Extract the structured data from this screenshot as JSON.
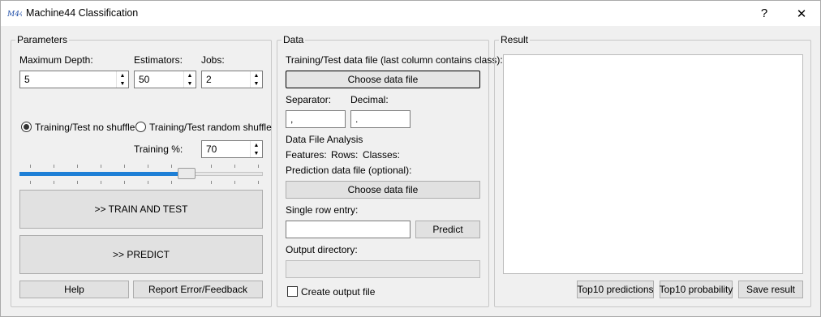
{
  "window": {
    "title": "Machine44 Classification",
    "help_glyph": "?",
    "close_glyph": "✕"
  },
  "parameters": {
    "group_title": "Parameters",
    "max_depth": {
      "label": "Maximum Depth:",
      "value": "5"
    },
    "estimators": {
      "label": "Estimators:",
      "value": "50"
    },
    "jobs": {
      "label": "Jobs:",
      "value": "2"
    },
    "radio_no_shuffle": "Training/Test no shuffle",
    "radio_random_shuffle": "Training/Test random shuffle",
    "selected_mode": "no_shuffle",
    "training_pct": {
      "label": "Training %:",
      "value": "70"
    },
    "slider_value_pct": 70,
    "train_button": ">> TRAIN AND TEST",
    "predict_button": ">> PREDICT",
    "help_button": "Help",
    "report_button": "Report Error/Feedback"
  },
  "data": {
    "group_title": "Data",
    "training_file_label": "Training/Test data file (last column contains class):",
    "choose_button_1": "Choose data file",
    "separator_label": "Separator:",
    "separator_value": ",",
    "decimal_label": "Decimal:",
    "decimal_value": ".",
    "analysis_label": "Data File Analysis",
    "features_label": "Features:",
    "rows_label": "Rows:",
    "classes_label": "Classes:",
    "prediction_file_label": "Prediction data file (optional):",
    "choose_button_2": "Choose data file",
    "single_row_label": "Single row entry:",
    "single_row_value": "",
    "predict_button": "Predict",
    "output_dir_label": "Output directory:",
    "output_dir_value": "",
    "create_output_label": "Create output file",
    "create_output_checked": false
  },
  "result": {
    "group_title": "Result",
    "text": "",
    "top10_predictions": "Top10 predictions",
    "top10_probability": "Top10 probability",
    "save_result": "Save result"
  }
}
